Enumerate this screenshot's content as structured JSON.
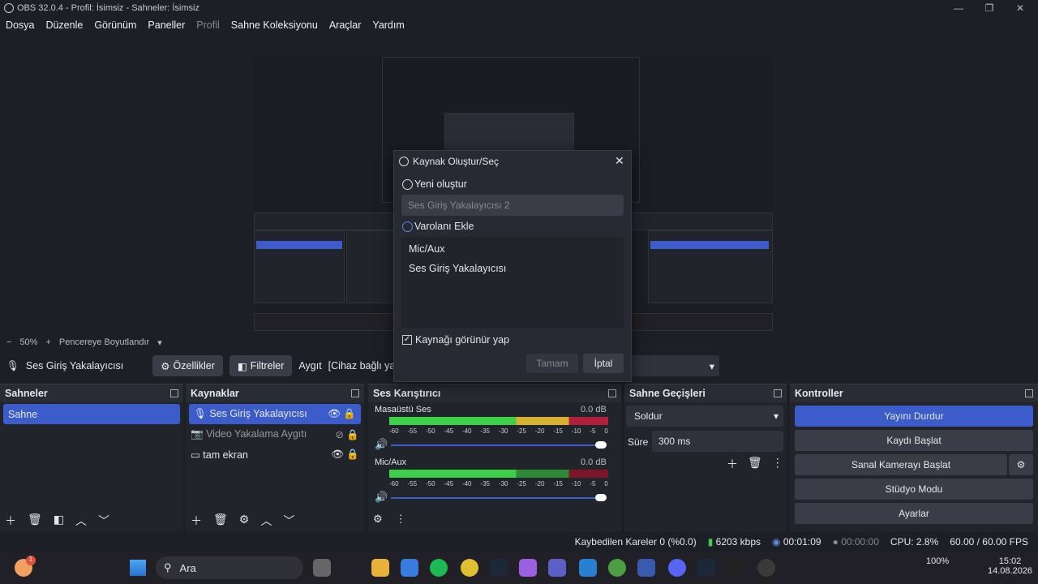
{
  "window": {
    "title": "OBS 32.0.4 - Profil: İsimsiz - Sahneler: İsimsiz"
  },
  "menu": [
    "Dosya",
    "Düzenle",
    "Görünüm",
    "Paneller",
    "Profil",
    "Sahne Koleksiyonu",
    "Araçlar",
    "Yardım"
  ],
  "zoom": {
    "minus": "−",
    "value": "50%",
    "plus": "+",
    "mode": "Pencereye Boyutlandır"
  },
  "source_toolbar": {
    "source_name": "Ses Giriş Yakalayıcısı",
    "properties": "Özellikler",
    "filters": "Filtreler",
    "device_label": "Aygıt",
    "device_value": "[Cihaz bağlı ya da"
  },
  "scenes": {
    "title": "Sahneler",
    "items": [
      "Sahne"
    ]
  },
  "sources": {
    "title": "Kaynaklar",
    "items": [
      "Ses Giriş Yakalayıcısı",
      "Video Yakalama Aygıtı",
      "tam ekran"
    ]
  },
  "mixer": {
    "title": "Ses Karıştırıcı",
    "channels": [
      {
        "name": "Masaüstü Ses",
        "db": "0.0 dB"
      },
      {
        "name": "Mic/Aux",
        "db": "0.0 dB"
      }
    ],
    "ticks": [
      "-60",
      "-55",
      "-50",
      "-45",
      "-40",
      "-35",
      "-30",
      "-25",
      "-20",
      "-15",
      "-10",
      "-5",
      "0"
    ]
  },
  "transitions": {
    "title": "Sahne Geçişleri",
    "selected": "Soldur",
    "duration_label": "Süre",
    "duration": "300 ms"
  },
  "controls": {
    "title": "Kontroller",
    "buttons": [
      "Yayını Durdur",
      "Kaydı Başlat",
      "Sanal Kamerayı Başlat",
      "Stüdyo Modu",
      "Ayarlar"
    ]
  },
  "status": {
    "dropped": "Kaybedilen Kareler 0 (%0.0)",
    "bitrate": "6203 kbps",
    "stream_time": "00:01:09",
    "rec_time": "00:00:00",
    "cpu": "CPU: 2.8%",
    "fps": "60.00 / 60.00 FPS"
  },
  "dialog": {
    "title": "Kaynak Oluştur/Seç",
    "new_label": "Yeni oluştur",
    "new_name": "Ses Giriş Yakalayıcısı 2",
    "existing_label": "Varolanı Ekle",
    "existing_items": [
      "Mic/Aux",
      "Ses Giriş Yakalayıcısı"
    ],
    "visible_label": "Kaynağı görünür yap",
    "ok": "Tamam",
    "cancel": "İptal"
  },
  "taskbar": {
    "search": "Ara",
    "battery": "100%",
    "time": "15:02",
    "date": "14.08.2026",
    "badge": "1"
  },
  "colors": {
    "accent": "#3b5cc9",
    "bg": "#1d1f26",
    "panel": "#22242c"
  }
}
